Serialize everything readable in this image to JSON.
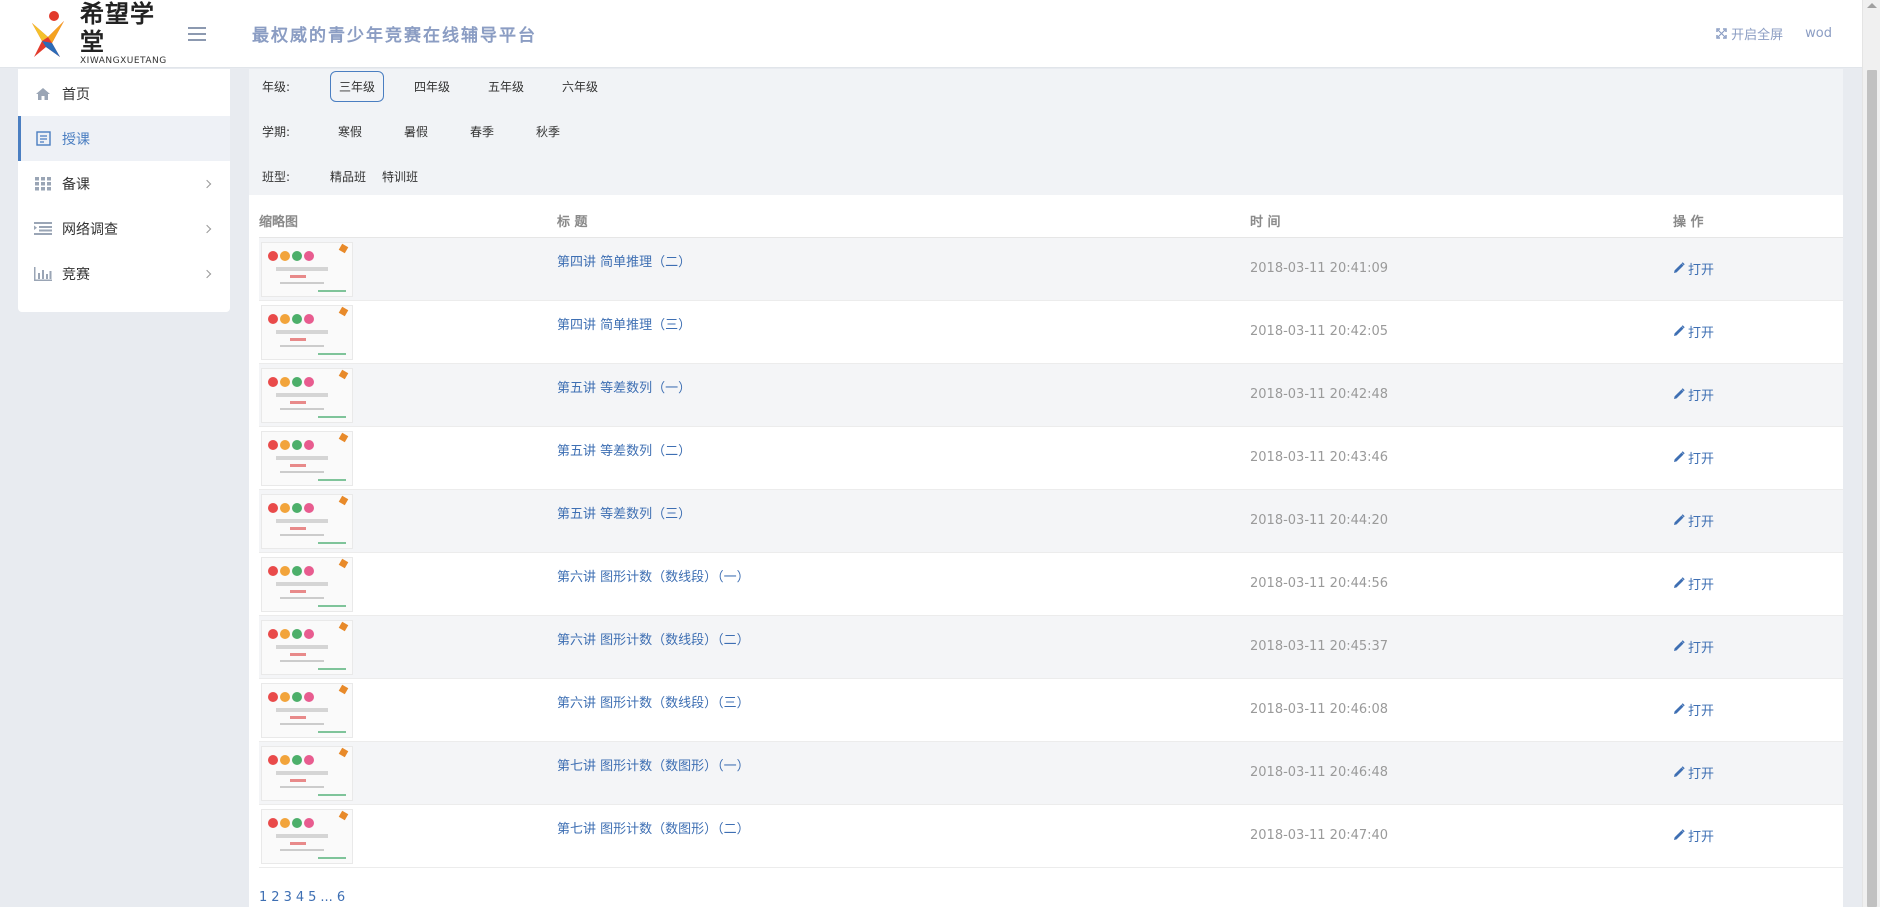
{
  "header": {
    "logo_cn": "希望学堂",
    "logo_en": "XIWANGXUETANG",
    "slogan": "最权威的青少年竞赛在线辅导平台",
    "fullscreen_label": "开启全屏",
    "username": "wod"
  },
  "sidebar": {
    "items": [
      {
        "label": "首页",
        "icon": "home-icon"
      },
      {
        "label": "授课",
        "icon": "lesson-icon"
      },
      {
        "label": "备课",
        "icon": "grid-icon"
      },
      {
        "label": "网络调查",
        "icon": "list-icon"
      },
      {
        "label": "竞赛",
        "icon": "bar-chart-icon"
      }
    ],
    "active_index": 1
  },
  "filters": {
    "grade_label": "年级:",
    "grades": [
      "三年级",
      "四年级",
      "五年级",
      "六年级"
    ],
    "term_label": "学期:",
    "terms": [
      "寒假",
      "暑假",
      "春季",
      "秋季"
    ],
    "class_label": "班型:",
    "classes": [
      "精品班",
      "特训班"
    ]
  },
  "table": {
    "headers": [
      "缩略图",
      "标 题",
      "时 间",
      "操 作"
    ],
    "open_label": "打开",
    "rows": [
      {
        "title": "第四讲 简单推理（二）",
        "time": "2018-03-11 20:41:09"
      },
      {
        "title": "第四讲 简单推理（三）",
        "time": "2018-03-11 20:42:05"
      },
      {
        "title": "第五讲 等差数列（一）",
        "time": "2018-03-11 20:42:48"
      },
      {
        "title": "第五讲 等差数列（二）",
        "time": "2018-03-11 20:43:46"
      },
      {
        "title": "第五讲 等差数列（三）",
        "time": "2018-03-11 20:44:20"
      },
      {
        "title": "第六讲 图形计数（数线段）（一）",
        "time": "2018-03-11 20:44:56"
      },
      {
        "title": "第六讲 图形计数（数线段）（二）",
        "time": "2018-03-11 20:45:37"
      },
      {
        "title": "第六讲 图形计数（数线段）（三）",
        "time": "2018-03-11 20:46:08"
      },
      {
        "title": "第七讲 图形计数（数图形）（一）",
        "time": "2018-03-11 20:46:48"
      },
      {
        "title": "第七讲 图形计数（数图形）（二）",
        "time": "2018-03-11 20:47:40"
      }
    ]
  },
  "pagination": {
    "pages": [
      "1",
      "2",
      "3",
      "4",
      "5"
    ],
    "ellipsis": "...",
    "last": "6"
  },
  "colors": {
    "accent": "#3e6fb3",
    "slogan": "#8b9dc3",
    "background": "#e8ebf0"
  }
}
